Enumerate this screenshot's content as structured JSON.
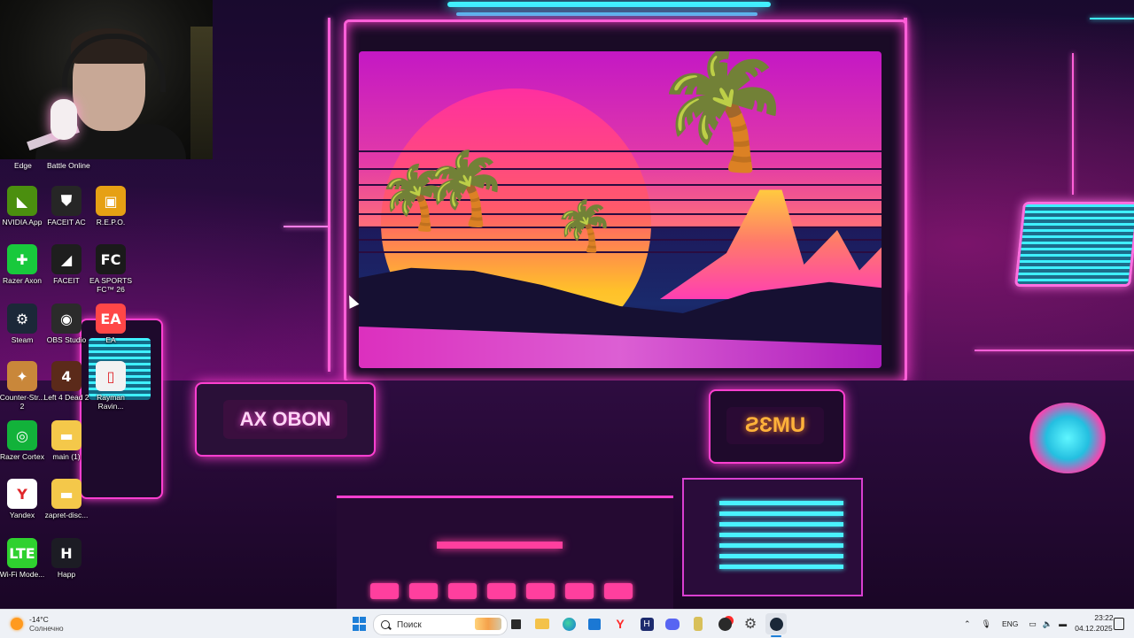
{
  "webcam": {
    "label": ""
  },
  "desktop": {
    "top_labels": [
      "Edge",
      "Battle Online"
    ],
    "icons": [
      {
        "label": "NVIDIA App",
        "glyph": "◣",
        "bg": "#4b8f0f"
      },
      {
        "label": "FACEIT AC",
        "glyph": "⛊",
        "bg": "#262626"
      },
      {
        "label": "R.E.P.O.",
        "glyph": "▣",
        "bg": "#e6a014"
      },
      {
        "label": "Razer Axon",
        "glyph": "✚",
        "bg": "#18c93c"
      },
      {
        "label": "FACEIT",
        "glyph": "◢",
        "bg": "#1e1e1e"
      },
      {
        "label": "EA SPORTS FC™ 26",
        "glyph": "FC",
        "bg": "#1a1a1a"
      },
      {
        "label": "Steam",
        "glyph": "⚙",
        "bg": "#1b2838"
      },
      {
        "label": "OBS Studio",
        "glyph": "◉",
        "bg": "#2b2b2b"
      },
      {
        "label": "EA",
        "glyph": "EA",
        "bg": "#ff4747"
      },
      {
        "label": "Counter-Str... 2",
        "glyph": "✦",
        "bg": "#c9873a"
      },
      {
        "label": "Left 4 Dead 2",
        "glyph": "4",
        "bg": "#5b2a1a"
      },
      {
        "label": "Rayman Ravin...",
        "glyph": "▯",
        "bg": "#f2f2f2"
      },
      {
        "label": "Razer Cortex",
        "glyph": "◎",
        "bg": "#12b23a"
      },
      {
        "label": "main (1)",
        "glyph": "▬",
        "bg": "#f4c84a"
      },
      {
        "label": "Yandex",
        "glyph": "Y",
        "bg": "#ffffff"
      },
      {
        "label": "zapret-disc...",
        "glyph": "▬",
        "bg": "#f4c84a"
      },
      {
        "label": "Wi-Fi Mode...",
        "glyph": "LTE",
        "bg": "#2fd12f"
      },
      {
        "label": "Happ",
        "glyph": "H",
        "bg": "#1c1c24"
      }
    ]
  },
  "wallpaper": {
    "console_left_text": "AX OBON",
    "console_right_text": "ƧƐMU"
  },
  "taskbar": {
    "weather_temp": "-14°C",
    "weather_condition": "Солнечно",
    "search_placeholder": "Поиск",
    "pinned_apps": [
      "file-explorer-icon",
      "folder-icon",
      "edge-icon",
      "store-icon",
      "yandex-icon",
      "happ-icon",
      "discord-icon",
      "vpn-icon",
      "app-icon",
      "settings-icon",
      "steam-icon"
    ],
    "language": "ENG",
    "time": "23:22",
    "date": "04.12.2025"
  }
}
